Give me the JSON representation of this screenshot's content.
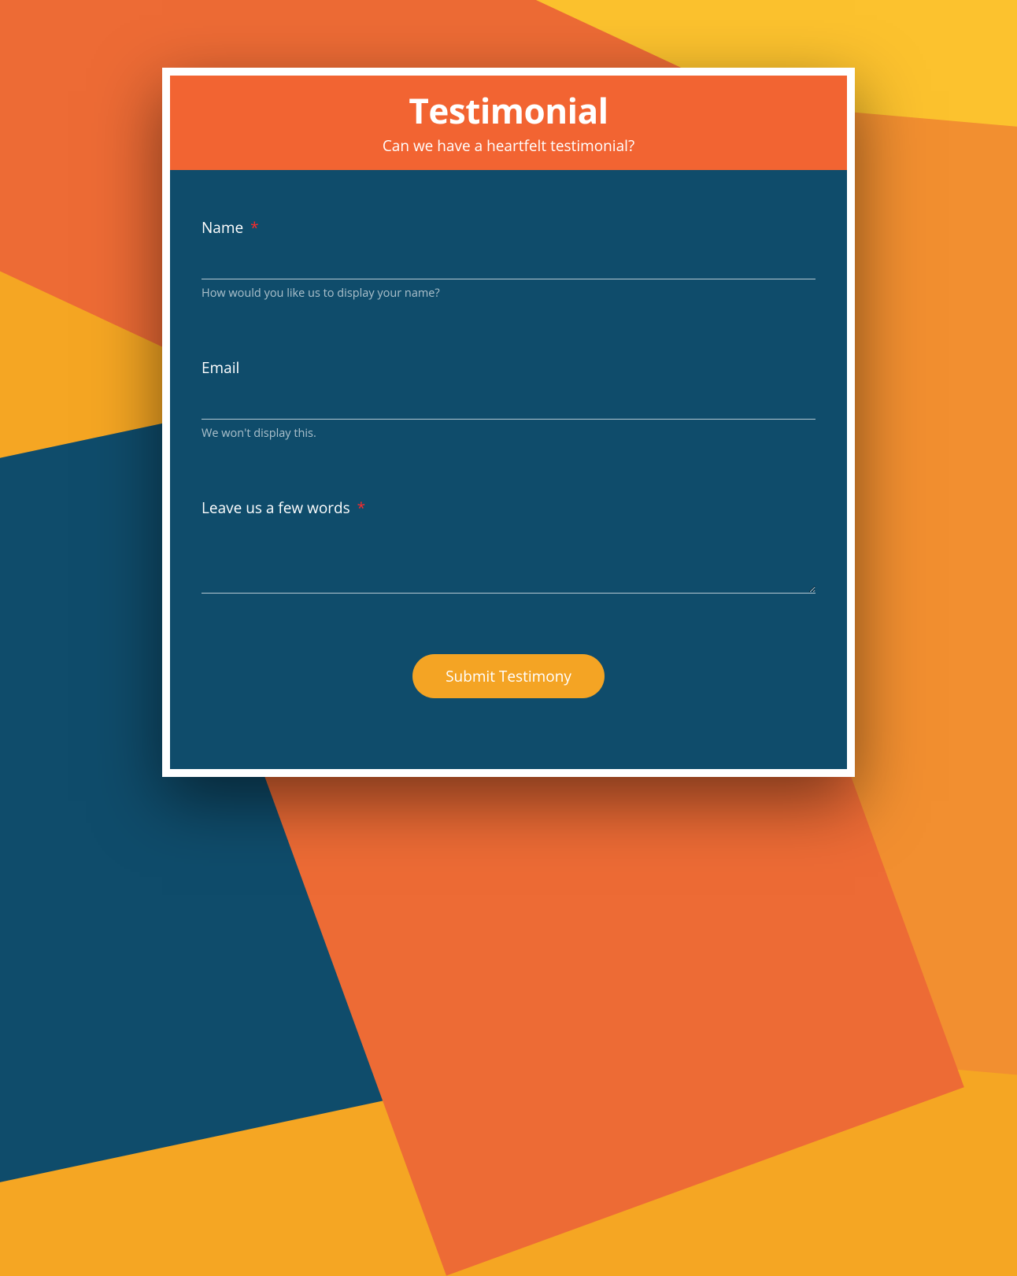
{
  "header": {
    "title": "Testimonial",
    "subtitle": "Can we have a heartfelt testimonial?"
  },
  "fields": {
    "name": {
      "label": "Name",
      "required": true,
      "required_mark": "*",
      "help": "How would you like us to display your name?",
      "value": ""
    },
    "email": {
      "label": "Email",
      "required": false,
      "help": "We won't display this.",
      "value": ""
    },
    "message": {
      "label": "Leave us a few words",
      "required": true,
      "required_mark": "*",
      "value": ""
    }
  },
  "submit": {
    "label": "Submit Testimony"
  },
  "colors": {
    "header_bg": "#f26432",
    "body_bg": "#0f4c6b",
    "button_bg": "#f4a424",
    "required": "#ff2a2a"
  }
}
